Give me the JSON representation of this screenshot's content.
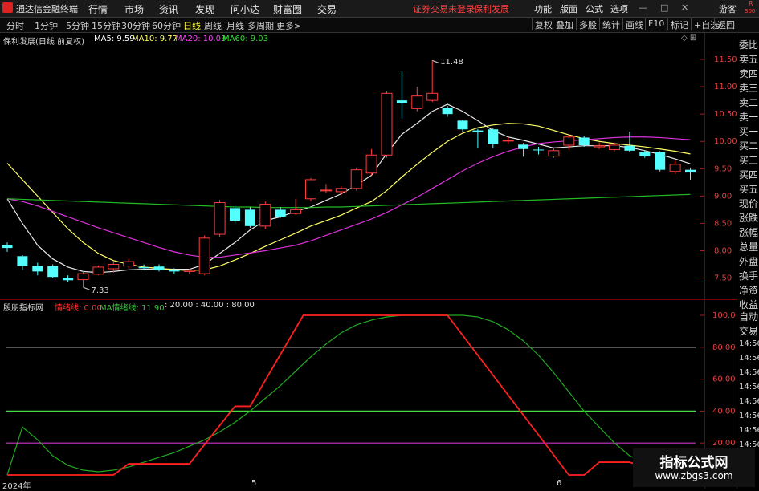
{
  "app": {
    "title": "通达信金融终端",
    "menus": [
      "行情",
      "市场",
      "资讯",
      "发现",
      "问小达",
      "财富圈",
      "交易"
    ],
    "warning": "证券交易未登录",
    "stock_name": "保利发展",
    "right_menus": [
      "功能",
      "版面",
      "公式",
      "选项"
    ],
    "user": "游客",
    "badge_r": "R",
    "badge_num": "300"
  },
  "toolbar": {
    "periods": [
      "分时",
      "1分钟",
      "5分钟",
      "15分钟",
      "30分钟",
      "60分钟",
      "日线",
      "周线",
      "月线",
      "多周期",
      "更多>"
    ],
    "active_period": "日线",
    "right_buttons": [
      "复权",
      "叠加",
      "多股",
      "统计",
      "画线",
      "F10",
      "标记",
      "+自选",
      "返回"
    ]
  },
  "price_panel": {
    "title": "保利发展(日线 前复权)",
    "ma": [
      {
        "label": "MA5: 9.59",
        "color": "#ffffff"
      },
      {
        "label": "MA10: 9.77",
        "color": "#ffff66"
      },
      {
        "label": "MA20: 10.03",
        "color": "#ff44ff"
      },
      {
        "label": "MA60: 9.03",
        "color": "#33dd33"
      }
    ],
    "y_ticks": [
      "11.50",
      "11.00",
      "10.50",
      "10.00",
      "9.50",
      "9.00",
      "8.50",
      "8.00",
      "7.50"
    ],
    "high_label": "11.48",
    "low_label": "7.33"
  },
  "indicator_panel": {
    "title": "殷朋指标网",
    "line1": "情绪线: 0.00",
    "line2": "MA情绪线: 11.90",
    "levels": ": 20.00 : 40.00 : 80.00",
    "y_ticks": [
      "100.0",
      "80.00",
      "60.00",
      "40.00",
      "20.00"
    ],
    "x_labels": [
      "2024年",
      "5",
      "6"
    ]
  },
  "side_panel": {
    "items": [
      "委比",
      "卖五",
      "卖四",
      "卖三",
      "卖二",
      "卖一",
      "买一",
      "买二",
      "买三",
      "买四",
      "买五",
      "现价",
      "涨跌",
      "涨幅",
      "总量",
      "外盘",
      "换手",
      "净资",
      "收益"
    ],
    "bottom_items": [
      "自动",
      "交易"
    ],
    "times": [
      "14:56",
      "14:56",
      "14:56",
      "14:56",
      "14:56",
      "14:56",
      "14:56",
      "14:56"
    ]
  },
  "watermark": {
    "line1": "指标公式网",
    "line2": "www.zbgs3.com"
  },
  "chart_data": {
    "type": "candlestick",
    "candles": [
      {
        "o": 8.1,
        "c": 8.05,
        "h": 8.15,
        "l": 7.98
      },
      {
        "o": 7.9,
        "c": 7.72,
        "h": 7.92,
        "l": 7.65
      },
      {
        "o": 7.72,
        "c": 7.62,
        "h": 7.78,
        "l": 7.55
      },
      {
        "o": 7.72,
        "c": 7.52,
        "h": 7.75,
        "l": 7.5
      },
      {
        "o": 7.5,
        "c": 7.46,
        "h": 7.55,
        "l": 7.42
      },
      {
        "o": 7.47,
        "c": 7.58,
        "h": 7.62,
        "l": 7.33
      },
      {
        "o": 7.57,
        "c": 7.7,
        "h": 7.73,
        "l": 7.55
      },
      {
        "o": 7.67,
        "c": 7.75,
        "h": 7.82,
        "l": 7.6
      },
      {
        "o": 7.72,
        "c": 7.8,
        "h": 7.85,
        "l": 7.68
      },
      {
        "o": 7.7,
        "c": 7.68,
        "h": 7.75,
        "l": 7.64
      },
      {
        "o": 7.71,
        "c": 7.65,
        "h": 7.75,
        "l": 7.62
      },
      {
        "o": 7.65,
        "c": 7.62,
        "h": 7.68,
        "l": 7.58
      },
      {
        "o": 7.62,
        "c": 7.64,
        "h": 7.67,
        "l": 7.58
      },
      {
        "o": 7.58,
        "c": 8.23,
        "h": 8.28,
        "l": 7.55
      },
      {
        "o": 8.3,
        "c": 8.88,
        "h": 8.93,
        "l": 8.25
      },
      {
        "o": 8.78,
        "c": 8.55,
        "h": 8.82,
        "l": 8.5
      },
      {
        "o": 8.75,
        "c": 8.45,
        "h": 8.8,
        "l": 8.42
      },
      {
        "o": 8.45,
        "c": 8.85,
        "h": 8.9,
        "l": 8.4
      },
      {
        "o": 8.75,
        "c": 8.62,
        "h": 8.8,
        "l": 8.6
      },
      {
        "o": 8.68,
        "c": 8.75,
        "h": 8.95,
        "l": 8.65
      },
      {
        "o": 8.95,
        "c": 9.3,
        "h": 9.33,
        "l": 8.9
      },
      {
        "o": 9.11,
        "c": 9.11,
        "h": 9.22,
        "l": 9.06
      },
      {
        "o": 9.08,
        "c": 9.14,
        "h": 9.18,
        "l": 9.02
      },
      {
        "o": 9.14,
        "c": 9.48,
        "h": 9.52,
        "l": 9.1
      },
      {
        "o": 9.42,
        "c": 9.75,
        "h": 9.86,
        "l": 9.38
      },
      {
        "o": 9.75,
        "c": 10.88,
        "h": 10.92,
        "l": 9.7
      },
      {
        "o": 10.75,
        "c": 10.7,
        "h": 11.28,
        "l": 10.42
      },
      {
        "o": 10.6,
        "c": 10.83,
        "h": 11.0,
        "l": 10.55
      },
      {
        "o": 10.75,
        "c": 10.88,
        "h": 11.48,
        "l": 10.72
      },
      {
        "o": 10.62,
        "c": 10.5,
        "h": 10.65,
        "l": 10.45
      },
      {
        "o": 10.38,
        "c": 10.22,
        "h": 10.4,
        "l": 10.18
      },
      {
        "o": 10.2,
        "c": 10.17,
        "h": 10.23,
        "l": 9.88
      },
      {
        "o": 10.22,
        "c": 9.95,
        "h": 10.25,
        "l": 9.88
      },
      {
        "o": 10.02,
        "c": 10.02,
        "h": 10.08,
        "l": 9.95
      },
      {
        "o": 9.94,
        "c": 9.86,
        "h": 9.97,
        "l": 9.72
      },
      {
        "o": 9.85,
        "c": 9.84,
        "h": 9.9,
        "l": 9.76
      },
      {
        "o": 9.73,
        "c": 9.83,
        "h": 9.88,
        "l": 9.7
      },
      {
        "o": 9.93,
        "c": 10.08,
        "h": 10.13,
        "l": 9.85
      },
      {
        "o": 10.07,
        "c": 9.93,
        "h": 10.1,
        "l": 9.9
      },
      {
        "o": 9.9,
        "c": 9.92,
        "h": 9.98,
        "l": 9.86
      },
      {
        "o": 9.85,
        "c": 9.93,
        "h": 9.98,
        "l": 9.82
      },
      {
        "o": 9.92,
        "c": 9.83,
        "h": 10.18,
        "l": 9.8
      },
      {
        "o": 9.8,
        "c": 9.73,
        "h": 9.83,
        "l": 9.7
      },
      {
        "o": 9.8,
        "c": 9.48,
        "h": 9.82,
        "l": 9.45
      },
      {
        "o": 9.45,
        "c": 9.58,
        "h": 9.65,
        "l": 9.4
      },
      {
        "o": 9.48,
        "c": 9.43,
        "h": 9.52,
        "l": 9.3
      }
    ],
    "ma_series": [
      {
        "name": "MA5",
        "color": "#e8e8e8",
        "values": [
          8.95,
          8.5,
          8.1,
          7.85,
          7.7,
          7.62,
          7.6,
          7.62,
          7.65,
          7.66,
          7.67,
          7.66,
          7.66,
          7.75,
          7.95,
          8.15,
          8.38,
          8.55,
          8.62,
          8.72,
          8.8,
          8.92,
          9.04,
          9.2,
          9.38,
          9.78,
          10.13,
          10.33,
          10.55,
          10.68,
          10.55,
          10.38,
          10.2,
          10.08,
          10.02,
          9.95,
          9.88,
          9.9,
          9.92,
          9.92,
          9.92,
          9.89,
          9.83,
          9.76,
          9.68,
          9.59
        ]
      },
      {
        "name": "MA10",
        "color": "#ffff66",
        "values": [
          9.6,
          9.3,
          9.0,
          8.7,
          8.4,
          8.15,
          7.95,
          7.82,
          7.75,
          7.7,
          7.68,
          7.65,
          7.64,
          7.65,
          7.72,
          7.83,
          7.95,
          8.08,
          8.2,
          8.32,
          8.45,
          8.55,
          8.65,
          8.78,
          8.9,
          9.1,
          9.35,
          9.58,
          9.8,
          10.0,
          10.15,
          10.25,
          10.3,
          10.33,
          10.32,
          10.28,
          10.2,
          10.12,
          10.05,
          10.0,
          9.96,
          9.93,
          9.9,
          9.86,
          9.82,
          9.77
        ]
      },
      {
        "name": "MA20",
        "color": "#dd33dd",
        "values": [
          8.95,
          8.9,
          8.82,
          8.72,
          8.62,
          8.52,
          8.42,
          8.33,
          8.24,
          8.15,
          8.06,
          7.98,
          7.92,
          7.88,
          7.88,
          7.92,
          7.96,
          8.0,
          8.05,
          8.1,
          8.18,
          8.28,
          8.38,
          8.48,
          8.58,
          8.7,
          8.84,
          8.98,
          9.14,
          9.3,
          9.46,
          9.6,
          9.72,
          9.82,
          9.9,
          9.96,
          9.99,
          10.01,
          10.03,
          10.05,
          10.07,
          10.08,
          10.08,
          10.07,
          10.05,
          10.03
        ]
      },
      {
        "name": "MA60",
        "color": "#22bb22",
        "values": [
          8.95,
          8.94,
          8.93,
          8.92,
          8.91,
          8.9,
          8.89,
          8.88,
          8.87,
          8.86,
          8.85,
          8.84,
          8.83,
          8.82,
          8.81,
          8.8,
          8.8,
          8.79,
          8.79,
          8.79,
          8.79,
          8.8,
          8.8,
          8.81,
          8.82,
          8.83,
          8.84,
          8.85,
          8.86,
          8.87,
          8.88,
          8.89,
          8.9,
          8.91,
          8.92,
          8.93,
          8.94,
          8.95,
          8.96,
          8.97,
          8.98,
          8.99,
          9.0,
          9.01,
          9.02,
          9.03
        ]
      }
    ],
    "indicator": {
      "red_line": [
        {
          "x": 0,
          "y": 0
        },
        {
          "x": 7,
          "y": 0
        },
        {
          "x": 8,
          "y": 7
        },
        {
          "x": 12,
          "y": 7
        },
        {
          "x": 15,
          "y": 43
        },
        {
          "x": 16,
          "y": 43
        },
        {
          "x": 19.5,
          "y": 100
        },
        {
          "x": 29,
          "y": 100
        },
        {
          "x": 37,
          "y": 0
        },
        {
          "x": 38,
          "y": 0
        },
        {
          "x": 39,
          "y": 8
        },
        {
          "x": 41,
          "y": 8
        },
        {
          "x": 42,
          "y": 5
        },
        {
          "x": 45,
          "y": 5
        }
      ],
      "green_line": [
        0,
        30,
        22,
        12,
        6,
        3,
        2,
        3,
        5,
        8,
        11,
        14,
        18,
        22,
        27,
        33,
        40,
        48,
        56,
        65,
        74,
        82,
        89,
        94,
        97,
        99,
        100,
        100,
        100,
        100,
        100,
        99,
        96,
        91,
        84,
        75,
        64,
        52,
        40,
        30,
        20,
        12,
        8,
        6,
        5,
        5
      ],
      "levels": [
        20,
        40,
        80
      ],
      "level_colors": [
        "#cc33cc",
        "#44dd44",
        "#d8d8d8"
      ]
    }
  }
}
